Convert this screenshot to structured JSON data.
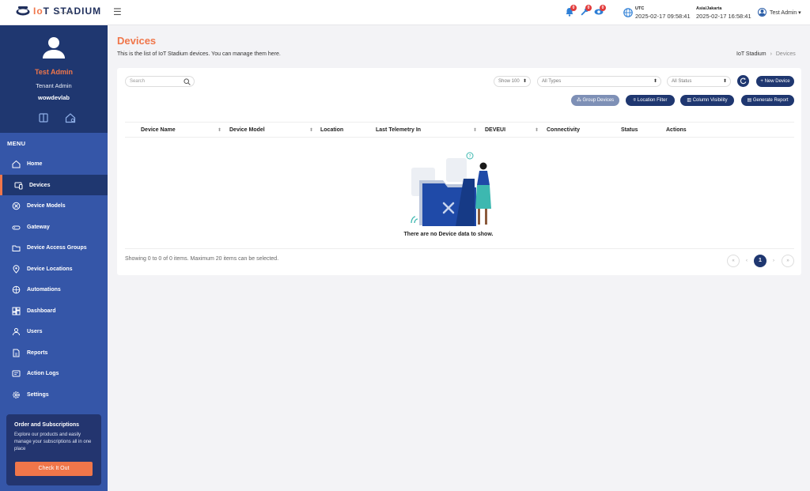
{
  "brand": {
    "name_prefix": "Io",
    "name_rest": "T STADIUM",
    "by": "by wowrack"
  },
  "header": {
    "notifications": [
      {
        "icon": "bell-icon",
        "count": "0"
      },
      {
        "icon": "wrench-icon",
        "count": "0"
      },
      {
        "icon": "eye-icon",
        "count": "0"
      }
    ],
    "tz1": {
      "label": "UTC",
      "time": "2025-02-17 09:58:41"
    },
    "tz2": {
      "label": "Asia/Jakarta",
      "time": "2025-02-17 16:58:41"
    },
    "user": "Test Admin ▾"
  },
  "profile": {
    "name": "Test Admin",
    "role": "Tenant Admin",
    "tenant": "wowdevlab"
  },
  "menu": {
    "title": "MENU",
    "items": [
      {
        "label": "Home",
        "icon": "home-icon"
      },
      {
        "label": "Devices",
        "icon": "devices-icon"
      },
      {
        "label": "Device Models",
        "icon": "device-models-icon"
      },
      {
        "label": "Gateway",
        "icon": "gateway-icon"
      },
      {
        "label": "Device Access Groups",
        "icon": "folder-icon"
      },
      {
        "label": "Device Locations",
        "icon": "location-pin-icon"
      },
      {
        "label": "Automations",
        "icon": "automation-icon"
      },
      {
        "label": "Dashboard",
        "icon": "dashboard-icon"
      },
      {
        "label": "Users",
        "icon": "user-icon"
      },
      {
        "label": "Reports",
        "icon": "report-icon"
      },
      {
        "label": "Action Logs",
        "icon": "action-log-icon"
      },
      {
        "label": "Settings",
        "icon": "gear-icon"
      }
    ]
  },
  "promo": {
    "title": "Order and Subscriptions",
    "desc": "Explore our products and easily manage your subscriptions all in one place",
    "button": "Check It Out"
  },
  "page": {
    "title": "Devices",
    "subtitle": "This is the list of IoT Stadium devices. You can manage them here.",
    "breadcrumb": {
      "root": "IoT Stadium",
      "sep": "›",
      "current": "Devices"
    }
  },
  "toolbar": {
    "search_placeholder": "Search",
    "show": "Show 100",
    "types": "All Types",
    "status": "All Status",
    "new_device": "+ New Device",
    "group_devices": "Group Devices",
    "location_filter": "Location Filter",
    "column_visibility": "Column Visibility",
    "generate_report": "Generate Report"
  },
  "table": {
    "columns": [
      "Device Name",
      "Device Model",
      "Location",
      "Last Telemetry In",
      "DEVEUI",
      "Connectivity",
      "Status",
      "Actions"
    ],
    "empty": "There are no Device data to show."
  },
  "footer": {
    "info": "Showing 0 to 0 of 0 items. Maximum 20 items can be selected.",
    "pages": [
      "«",
      "‹",
      "1",
      "›",
      "»"
    ]
  },
  "colors": {
    "accent": "#f0764a",
    "navy": "#1f3770",
    "sidebar": "#3556a8"
  }
}
